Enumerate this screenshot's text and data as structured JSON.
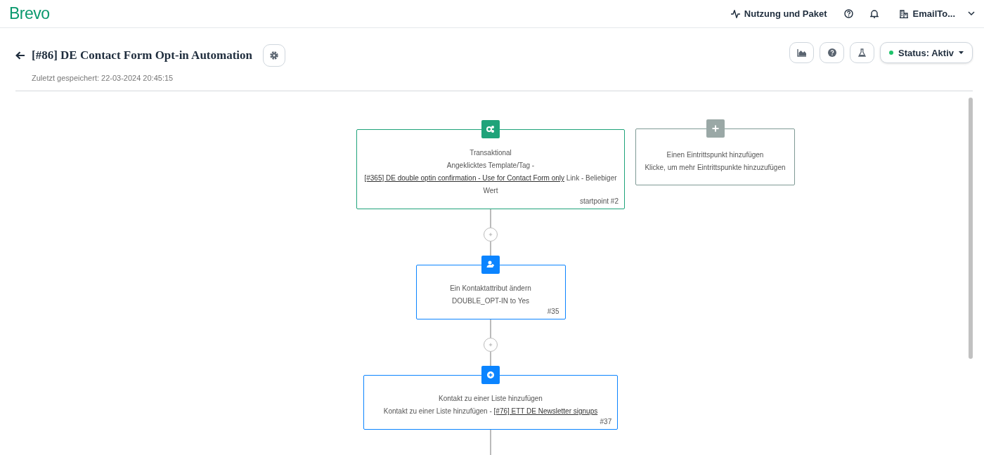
{
  "header": {
    "logo": "Brevo",
    "usage_link": "Nutzung und Paket",
    "account": "EmailTo..."
  },
  "automation": {
    "title": "[#86] DE Contact Form Opt-in Automation",
    "saved": "Zuletzt gespeichert: 22-03-2024 20:45:15",
    "status": {
      "label": "Status: Aktiv",
      "active": true
    }
  },
  "workflow": {
    "steps": [
      {
        "kind": "trigger",
        "title": "Transaktional",
        "description": [
          {
            "text": "Angeklicktes Template/Tag - "
          },
          {
            "text": "[#365] DE double optin confirmation - Use for Contact Form only",
            "link": true
          },
          {
            "text": " Link - Beliebiger Wert"
          }
        ],
        "id_label": "startpoint #2"
      },
      {
        "kind": "update-contact",
        "title": "Ein Kontaktattribut ändern",
        "description": [
          {
            "text": "DOUBLE_OPT-IN to Yes"
          }
        ],
        "id_label": "#35"
      },
      {
        "kind": "add-to-list",
        "title": "Kontakt zu einer Liste hinzufügen",
        "description": [
          {
            "text": "Kontakt zu einer Liste hinzufügen - "
          },
          {
            "text": "[#76] ETT DE Newsletter signups",
            "link": true
          }
        ],
        "id_label": "#37"
      }
    ],
    "add_entry": {
      "title": "Einen Eintrittspunkt hinzufügen",
      "subtitle": "Klicke, um mehr Eintrittspunkte hinzuzufügen"
    }
  }
}
